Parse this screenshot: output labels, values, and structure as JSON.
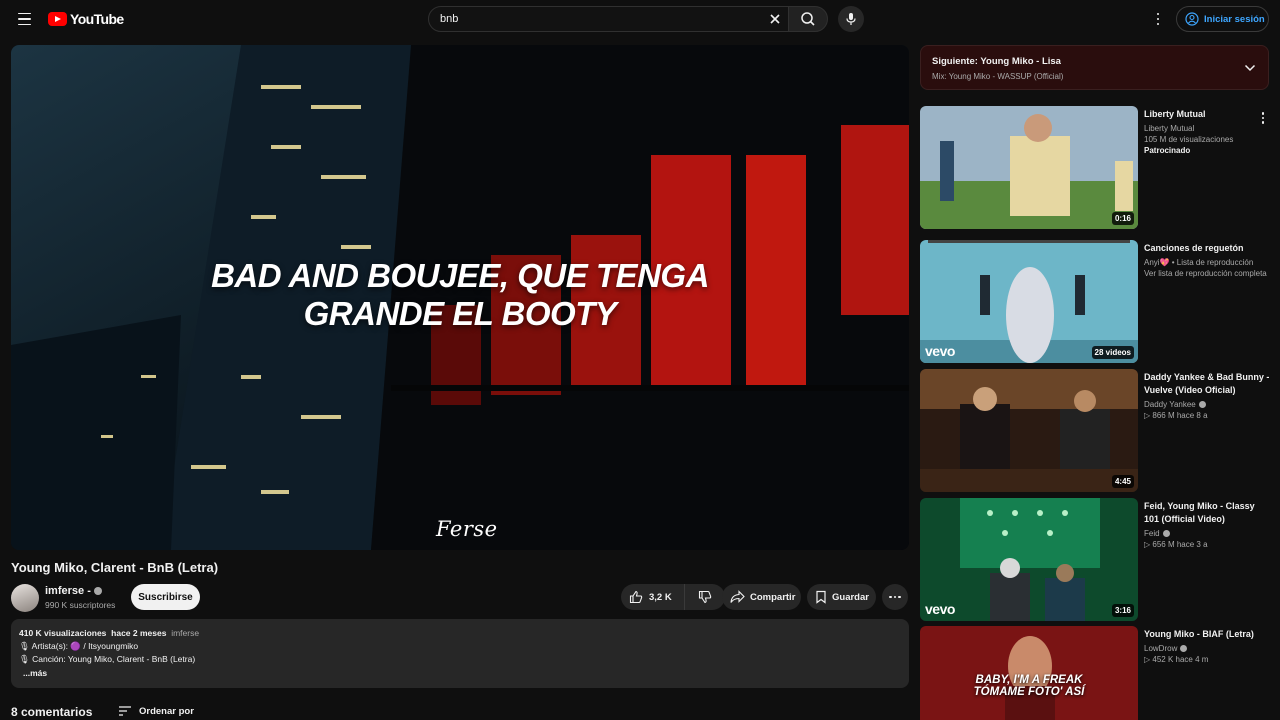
{
  "masthead": {
    "logo_text": "YouTube",
    "search_value": "bnb",
    "signin_label": "Iniciar sesión"
  },
  "player": {
    "lyric_line1": "BAD AND BOUJEE, QUE TENGA",
    "lyric_line2": "GRANDE EL BOOTY",
    "watermark": "Ferse"
  },
  "video": {
    "title": "Young Miko, Clarent - BnB (Letra)",
    "channel": "imferse -",
    "subscribers": "990 K suscriptores",
    "subscribe_label": "Suscribirse",
    "likes": "3,2 K",
    "share_label": "Compartir",
    "save_label": "Guardar"
  },
  "description": {
    "views": "410 K visualizaciones",
    "date": "hace 2 meses",
    "channel_tag": "imferse",
    "artist_line": "🎙 Artista(s):  🟣 / Itsyoungmiko",
    "song_line": "🎙 Canción: Young Miko, Clarent - BnB (Letra)",
    "more_label": "...más"
  },
  "comments": {
    "count_label": "8 comentarios",
    "sort_label": "Ordenar por"
  },
  "up_next": {
    "title": "Siguiente: Young Miko - Lisa",
    "subtitle": "Mix: Young Miko - WASSUP (Official)"
  },
  "recommendations": [
    {
      "title": "Liberty Mutual",
      "channel": "Liberty Mutual",
      "stats": "105 M de visualizaciones",
      "sponsored": "Patrocinado",
      "duration": "0:16"
    },
    {
      "title": "Canciones de reguetón",
      "channel": "Anyi💖 • Lista de reproducción",
      "stats": "Ver lista de reproducción completa",
      "duration": "28 videos",
      "brand": "vevo"
    },
    {
      "title": "Daddy Yankee & Bad Bunny - Vuelve (Video Oficial)",
      "channel": "Daddy Yankee",
      "stats": "866 M  hace 8 a",
      "duration": "4:45"
    },
    {
      "title": "Feid, Young Miko - Classy 101 (Official Video)",
      "channel": "Feid",
      "stats": "656 M  hace 3 a",
      "duration": "3:16",
      "brand": "vevo"
    },
    {
      "title": "Young Miko - BIAF (Letra)",
      "channel": "LowDrow",
      "stats": "452 K  hace 4 m",
      "thumb_line1": "BABY, I'M A FREAK",
      "thumb_line2": "TÓMAME FOTO' ASÍ"
    }
  ],
  "colors": {
    "background": "#0f0f0f",
    "accent": "#ff0000",
    "link": "#3ea6ff"
  }
}
